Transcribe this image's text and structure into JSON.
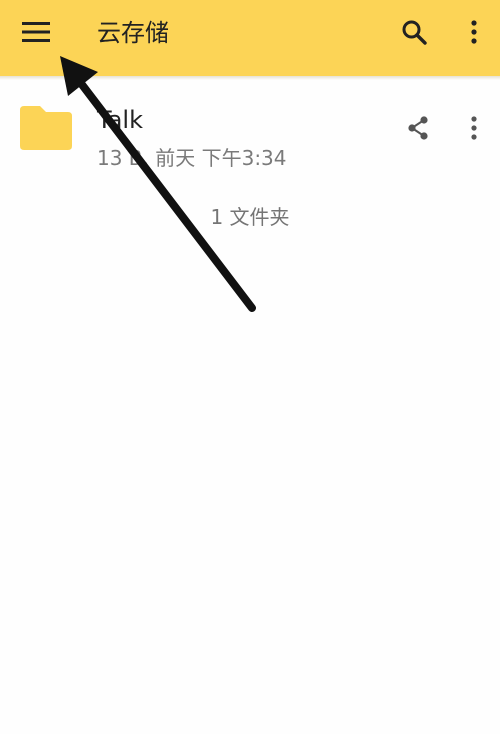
{
  "appbar": {
    "title": "云存储",
    "menu_icon": "hamburger-menu-icon",
    "search_icon": "search-icon",
    "more_icon": "more-vert-icon"
  },
  "file": {
    "name": "Talk",
    "meta": "13 B, 前天 下午3:34",
    "folder_icon": "folder-icon",
    "share_icon": "share-icon",
    "more_icon": "more-vert-icon"
  },
  "summary": {
    "count": "1 文件夹"
  },
  "colors": {
    "appbar": "#fcd456",
    "folder": "#fcd456",
    "arrow": "#111111"
  }
}
